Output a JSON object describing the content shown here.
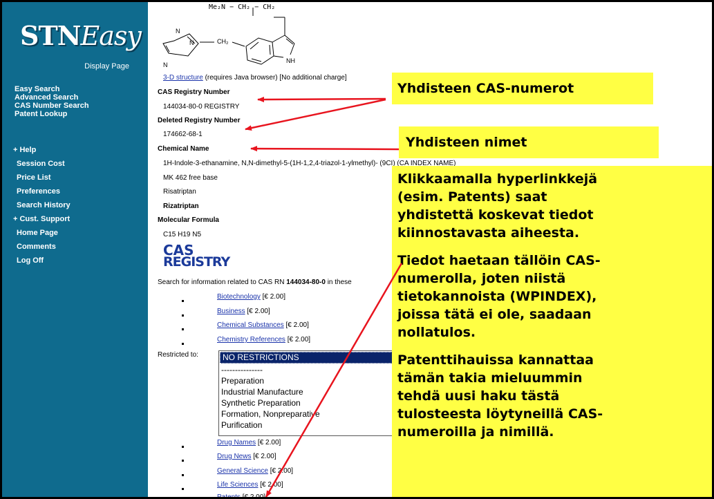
{
  "logo": {
    "stn": "STN",
    "easy": "Easy"
  },
  "display_page": "Display Page",
  "nav_top": [
    "Easy Search",
    "Advanced Search",
    "CAS Number Search",
    "Patent Lookup"
  ],
  "nav_bottom": [
    "+ Help",
    "Session Cost",
    "Price List",
    "Preferences",
    "Search History",
    "+ Cust. Support",
    "Home Page",
    "Comments",
    "Log Off"
  ],
  "structure": {
    "top_formula": "Me₂N − CH₂ − CH₂",
    "n1": "N",
    "n2": "N",
    "ch2": "CH₂",
    "nh": "NH",
    "n3": "N"
  },
  "record": {
    "structure_link": "3-D structure",
    "structure_note": "(requires Java browser) [No additional charge]",
    "cas_label": "CAS Registry Number",
    "cas_value": "144034-80-0 REGISTRY",
    "deleted_label": "Deleted Registry Number",
    "deleted_value": "174662-68-1",
    "chem_name_label": "Chemical Name",
    "names": [
      "1H-Indole-3-ethanamine, N,N-dimethyl-5-(1H-1,2,4-triazol-1-ylmethyl)- (9CI) (CA INDEX NAME)",
      "MK 462 free base",
      "Risatriptan",
      "Rizatriptan"
    ],
    "formula_label": "Molecular Formula",
    "formula_value": "C15 H19 N5"
  },
  "cas_registry_logo": {
    "line1": "CAS",
    "line2": "REGISTRY"
  },
  "search_info": {
    "prefix": "Search for information related to CAS RN ",
    "rn": "144034-80-0",
    "suffix": " in these"
  },
  "links_top": [
    {
      "label": "Biotechnology",
      "price": "[€ 2.00]"
    },
    {
      "label": "Business",
      "price": "[€ 2.00]"
    },
    {
      "label": "Chemical Substances",
      "price": "[€ 2.00]"
    },
    {
      "label": "Chemistry References",
      "price": "[€ 2.00]"
    }
  ],
  "restricted_label": "Restricted to:",
  "restrictions": [
    "NO RESTRICTIONS",
    "---------------",
    "Preparation",
    "Industrial Manufacture",
    "Synthetic Preparation",
    "Formation, Nonpreparative",
    "Purification"
  ],
  "links_bottom": [
    {
      "label": "Drug Names",
      "price": "[€ 2.00]"
    },
    {
      "label": "Drug News",
      "price": "[€ 2.00]"
    },
    {
      "label": "General Science",
      "price": "[€ 2.00]"
    },
    {
      "label": "Life Sciences",
      "price": "[€ 2.00]"
    },
    {
      "label": "Patents",
      "price": "[€ 2.00]"
    }
  ],
  "callouts": {
    "cas_numbers": "Yhdisteen CAS-numerot",
    "names": "Yhdisteen nimet",
    "para1": [
      "Klikkaamalla hyperlinkkejä",
      "(esim. Patents) saat",
      "yhdistettä koskevat tiedot",
      "kiinnostavasta aiheesta."
    ],
    "para2": [
      "Tiedot haetaan tällöin CAS-",
      "numerolla, joten niistä",
      "tietokannoista (WPINDEX),",
      "joissa tätä ei ole, saadaan",
      "nollatulos."
    ],
    "para3": [
      "Patenttihauissa kannattaa",
      "tämän takia mieluummin",
      "tehdä uusi haku tästä",
      "tulosteesta löytyneillä CAS-",
      "numeroilla ja nimillä."
    ]
  },
  "colors": {
    "sidebar": "#0f6b8e",
    "callout": "#ffff44",
    "arrow": "#e8141e",
    "link": "#1a33aa"
  }
}
